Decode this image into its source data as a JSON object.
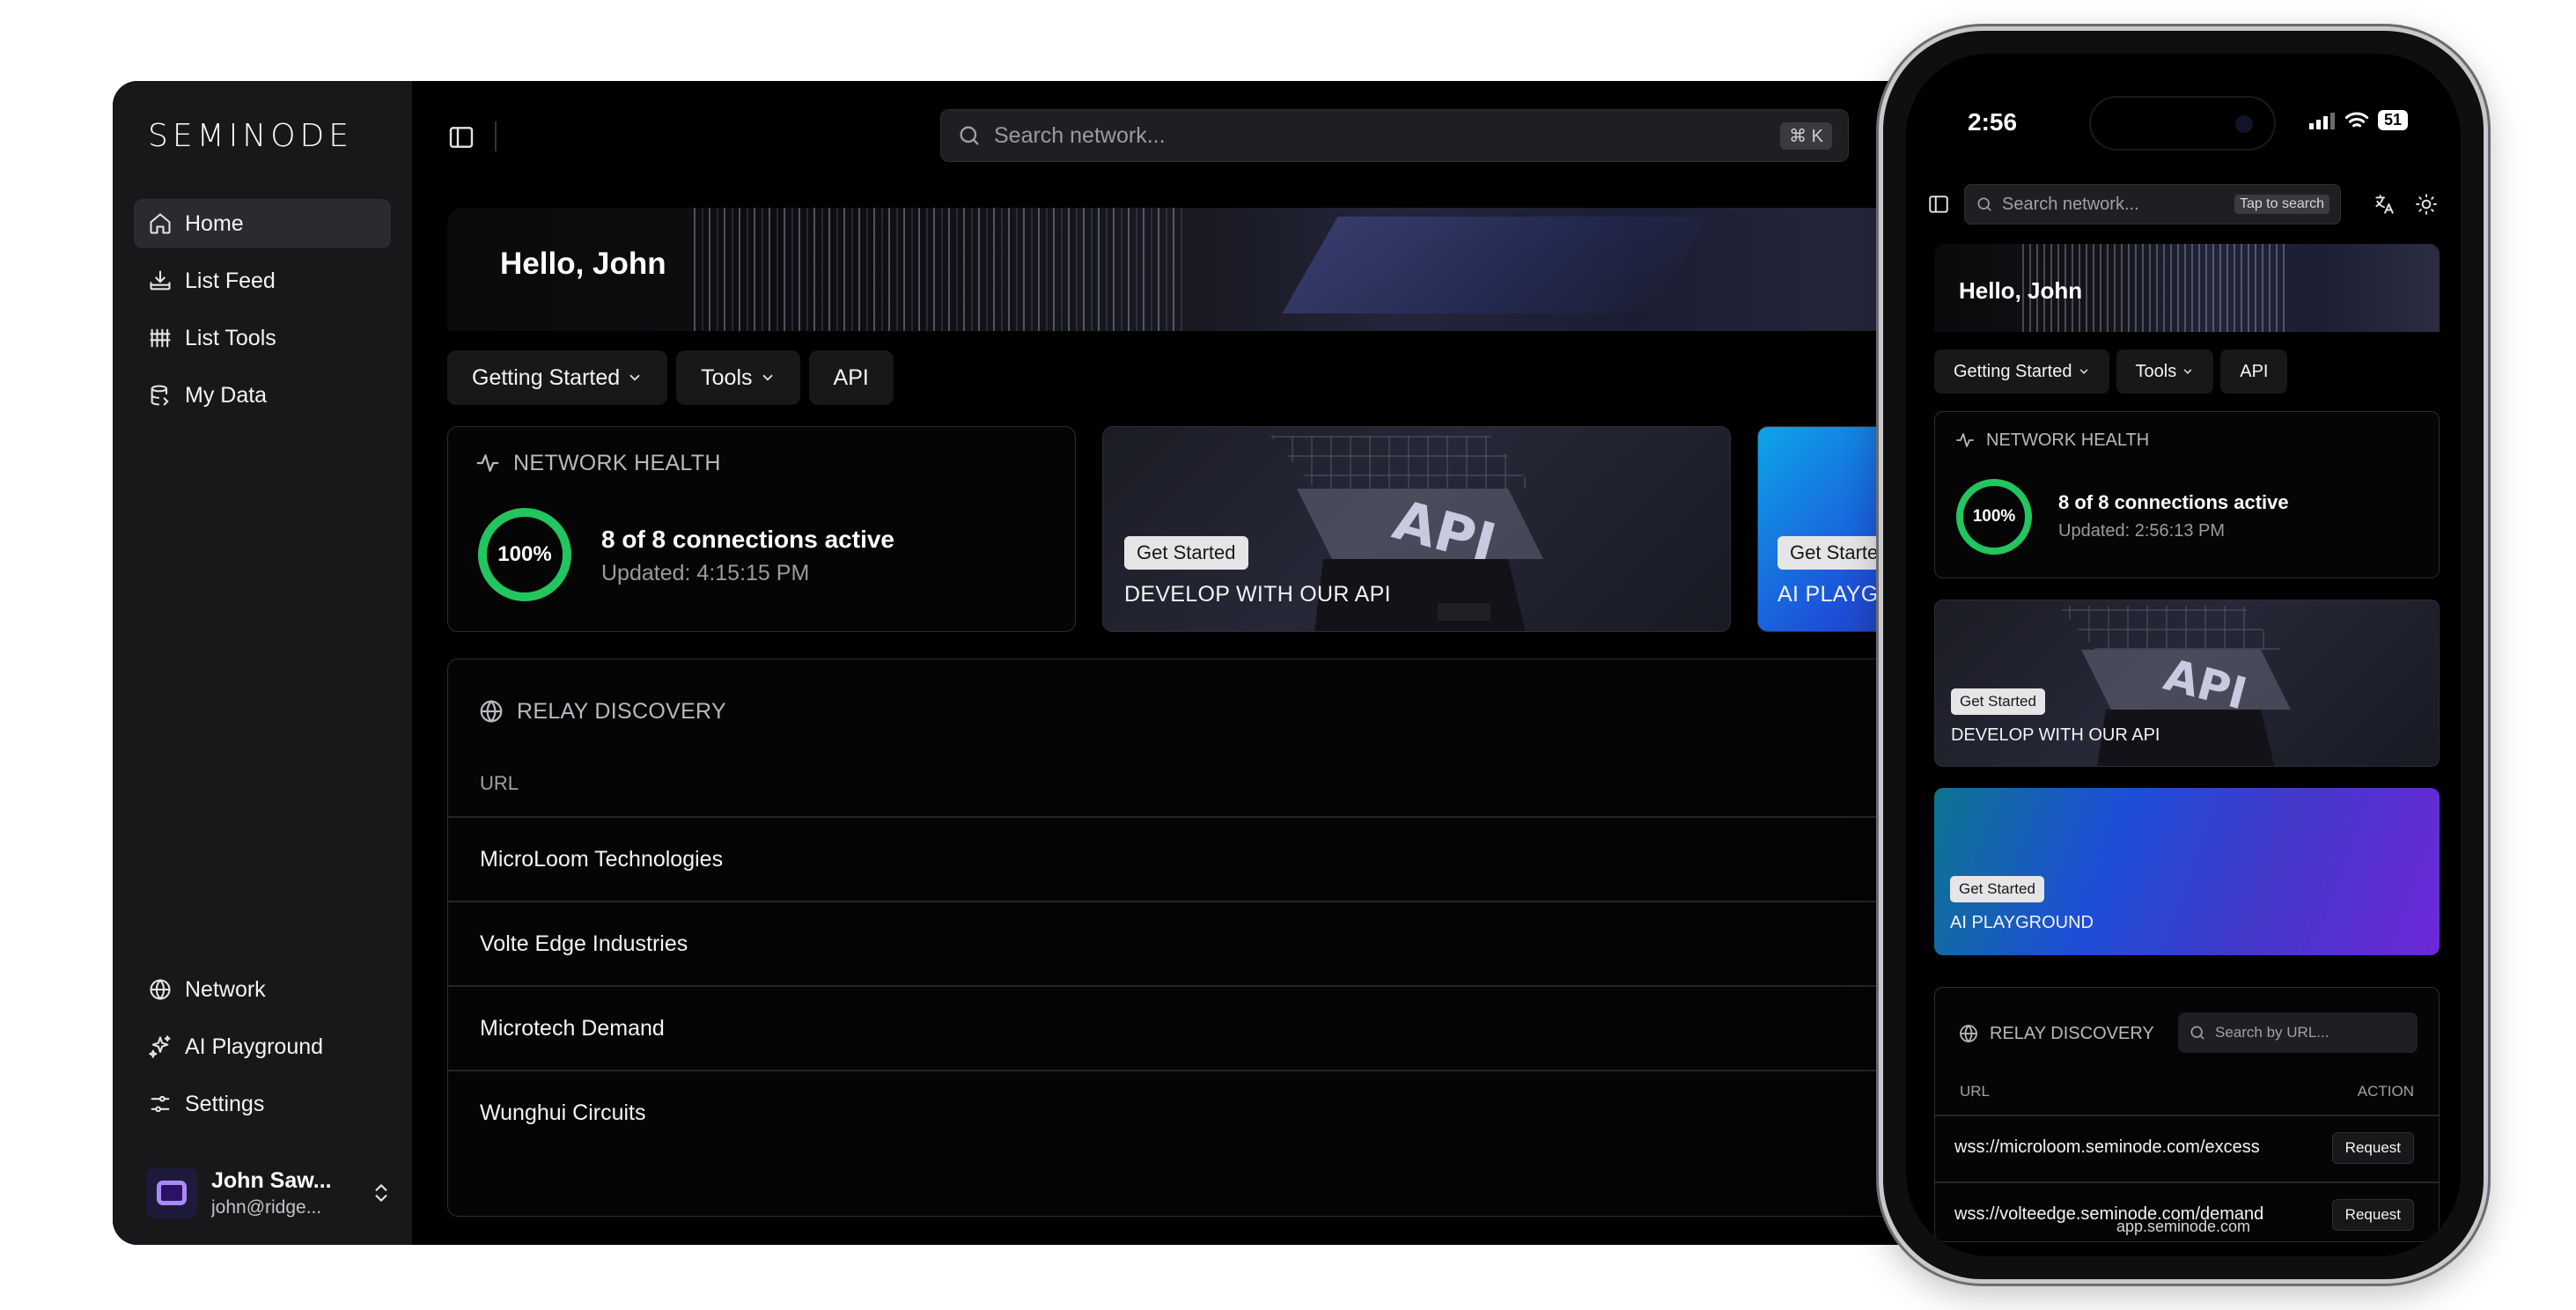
{
  "brand": {
    "logo_text": "SEMINODE"
  },
  "sidebar": {
    "top_items": [
      {
        "label": "Home",
        "icon": "home-icon",
        "active": true
      },
      {
        "label": "List Feed",
        "icon": "inbox-download-icon"
      },
      {
        "label": "List Tools",
        "icon": "grid-tools-icon"
      },
      {
        "label": "My Data",
        "icon": "database-icon"
      }
    ],
    "bottom_items": [
      {
        "label": "Network",
        "icon": "globe-icon"
      },
      {
        "label": "AI Playground",
        "icon": "sparkles-icon"
      },
      {
        "label": "Settings",
        "icon": "sliders-icon"
      }
    ],
    "user": {
      "name": "John Saw...",
      "email": "john@ridge..."
    }
  },
  "desktop": {
    "search": {
      "placeholder": "Search network...",
      "shortcut": "⌘ K"
    },
    "hero": {
      "greeting": "Hello, John"
    },
    "chips": [
      "Getting Started",
      "Tools",
      "API"
    ],
    "network_health": {
      "title": "NETWORK HEALTH",
      "percent": "100%",
      "status": "8 of 8 connections active",
      "updated": "Updated: 4:15:15 PM"
    },
    "promos": [
      {
        "badge": "Get Started",
        "title": "DEVELOP WITH OUR API"
      },
      {
        "badge": "Get Started",
        "title": "AI PLAYGROUND"
      }
    ],
    "relay": {
      "title": "RELAY DISCOVERY",
      "column_url": "URL",
      "rows": [
        "MicroLoom Technologies",
        "Volte Edge Industries",
        "Microtech Demand",
        "Wunghui Circuits"
      ]
    }
  },
  "phone": {
    "status": {
      "time": "2:56",
      "battery": "51"
    },
    "search": {
      "placeholder": "Search network...",
      "hint": "Tap to search"
    },
    "hero": {
      "greeting": "Hello, John"
    },
    "chips": [
      "Getting Started",
      "Tools",
      "API"
    ],
    "network_health": {
      "title": "NETWORK HEALTH",
      "percent": "100%",
      "status": "8 of 8 connections active",
      "updated": "Updated: 2:56:13 PM"
    },
    "promos": [
      {
        "badge": "Get Started",
        "title": "DEVELOP WITH OUR API"
      },
      {
        "badge": "Get Started",
        "title": "AI PLAYGROUND"
      }
    ],
    "relay": {
      "title": "RELAY DISCOVERY",
      "search_placeholder": "Search by URL...",
      "column_url": "URL",
      "column_action": "ACTION",
      "rows": [
        {
          "url": "wss://microloom.seminode.com/excess",
          "action": "Request"
        },
        {
          "url": "wss://volteedge.seminode.com/demand",
          "action": "Request"
        }
      ]
    },
    "url_bar": "app.seminode.com"
  },
  "colors": {
    "accent_green": "#22c55e",
    "avatar_purple": "#a78bfa"
  }
}
